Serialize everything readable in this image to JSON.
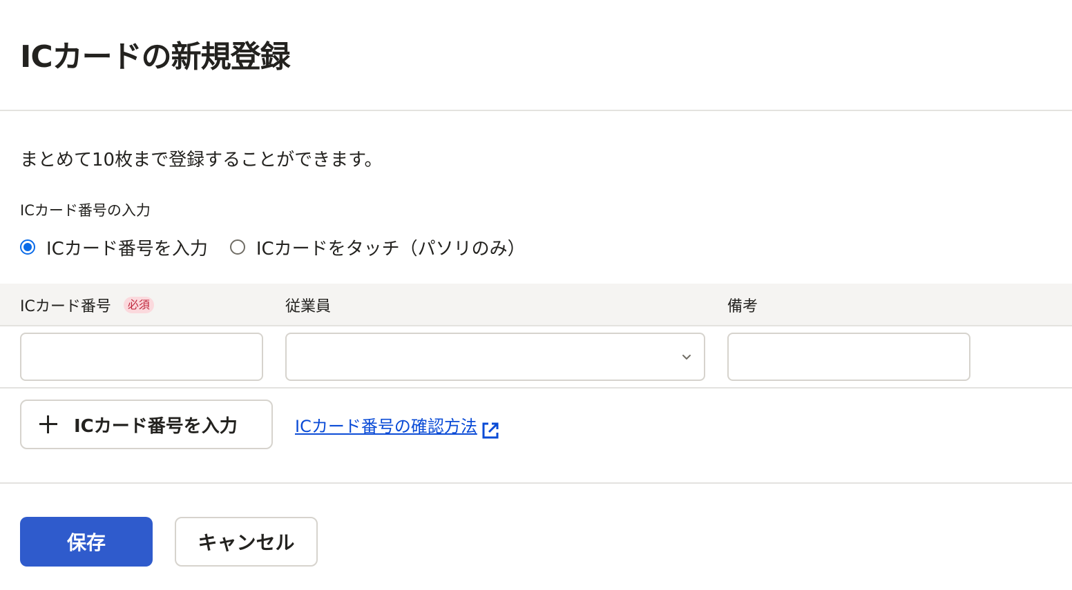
{
  "header": {
    "title": "ICカードの新規登録"
  },
  "form": {
    "description": "まとめて10枚まで登録することができます。",
    "input_method": {
      "label": "ICカード番号の入力",
      "options": [
        {
          "label": "ICカード番号を入力",
          "selected": true
        },
        {
          "label": "ICカードをタッチ（パソリのみ）",
          "selected": false
        }
      ]
    },
    "table": {
      "columns": [
        {
          "label": "ICカード番号",
          "badge": "必須"
        },
        {
          "label": "従業員"
        },
        {
          "label": "備考"
        }
      ],
      "rows": [
        {
          "card_number": "",
          "employee": "",
          "notes": ""
        }
      ]
    },
    "add_button_label": "ICカード番号を入力",
    "help_link_label": "ICカード番号の確認方法"
  },
  "footer": {
    "save_label": "保存",
    "cancel_label": "キャンセル"
  },
  "colors": {
    "primary": "#2f5bcc",
    "radio_selected": "#0a6be8",
    "link": "#0a4bd6",
    "required_badge_bg": "#fbd9dd",
    "required_badge_text": "#c0283d"
  }
}
